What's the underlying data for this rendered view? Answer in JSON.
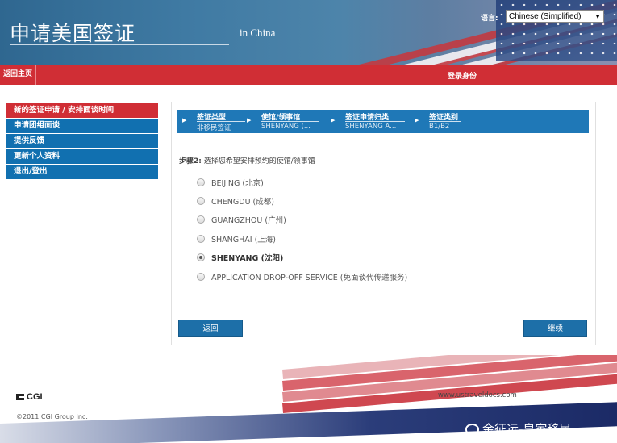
{
  "header": {
    "title": "申请美国签证",
    "subtitle": "in China",
    "language_label": "语言:",
    "language_selected": "Chinese (Simplified)",
    "language_arrow": "▼"
  },
  "topbar": {
    "home_link": "返回主页",
    "identity_label": "登录身份"
  },
  "leftnav": {
    "items": [
      {
        "label": "新的签证申请 / 安排面谈时间",
        "active": true
      },
      {
        "label": "申请团组面谈"
      },
      {
        "label": "提供反馈"
      },
      {
        "label": "更新个人资料"
      },
      {
        "label": "退出/登出"
      }
    ]
  },
  "steps": [
    {
      "label": "签证类型",
      "value": "非移民签证"
    },
    {
      "label": "使馆/领事馆",
      "value": "SHENYANG (..."
    },
    {
      "label": "签证申请归类",
      "value": "SHENYANG A..."
    },
    {
      "label": "签证类别",
      "value": "B1/B2"
    }
  ],
  "prompt": {
    "step": "步骤2:",
    "text": "选择您希望安排预约的使馆/领事馆"
  },
  "options": [
    {
      "label": "BEIJING (北京)",
      "selected": false
    },
    {
      "label": "CHENGDU (成都)",
      "selected": false
    },
    {
      "label": "GUANGZHOU (广州)",
      "selected": false
    },
    {
      "label": "SHANGHAI (上海)",
      "selected": false
    },
    {
      "label": "SHENYANG (沈阳)",
      "selected": true
    },
    {
      "label": "APPLICATION DROP-OFF SERVICE (免面谈代传递服务)",
      "selected": false
    }
  ],
  "buttons": {
    "back": "返回",
    "continue": "继续"
  },
  "footer": {
    "logo_text": "CGI",
    "copyright": "©2011 CGI Group Inc.",
    "url": "www.ustraveldocs.com",
    "watermark": "金征远-皇家移民"
  },
  "colors": {
    "header_blue": "#2f6790",
    "red_bar": "#d02e35",
    "nav_blue": "#1170b0",
    "step_blue": "#1f78b7",
    "button_blue": "#1d6fa8"
  }
}
